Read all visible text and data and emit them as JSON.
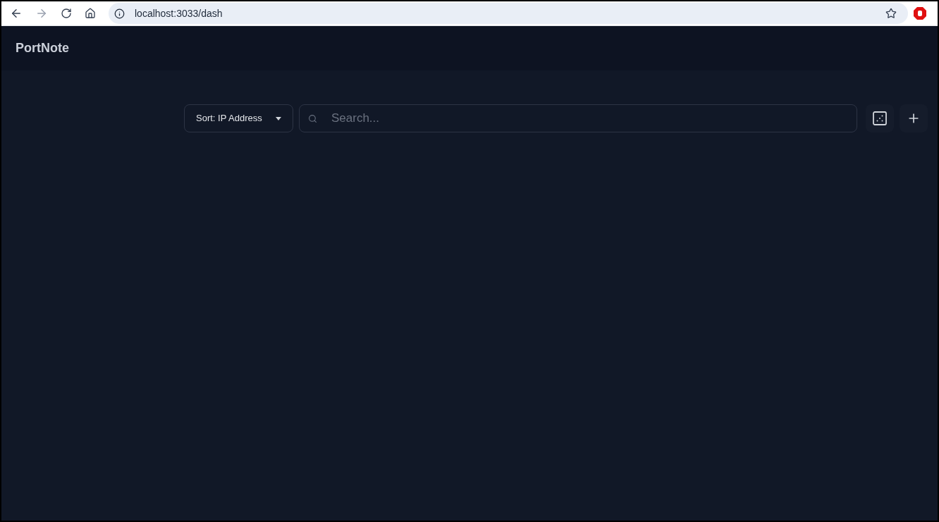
{
  "browser": {
    "url": "localhost:3033/dash"
  },
  "header": {
    "title": "PortNote"
  },
  "toolbar": {
    "sort": {
      "label": "Sort: IP Address"
    },
    "search": {
      "placeholder": "Search..."
    }
  }
}
